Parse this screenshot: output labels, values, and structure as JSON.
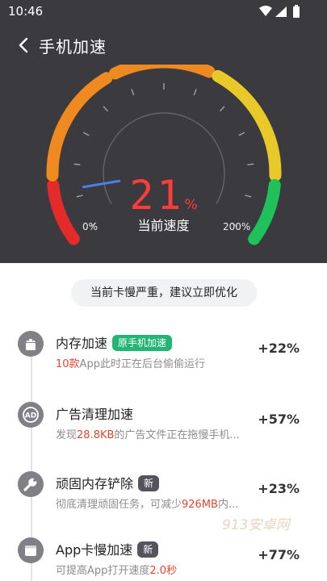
{
  "status_bar": {
    "time": "10:46"
  },
  "header": {
    "title": "手机加速"
  },
  "gauge": {
    "value": "21",
    "unit": "%",
    "value_fraction": 0.105,
    "label": "当前速度",
    "min_label": "0%",
    "max_label": "200%",
    "colors": {
      "red": "#e52a2a",
      "orange": "#ef8a20",
      "yellow": "#e9c82a",
      "green": "#1fc25a",
      "needle": "#4b7cf0"
    }
  },
  "warning": {
    "text": "当前卡慢严重，建议立即优化"
  },
  "items": [
    {
      "icon": "android-icon",
      "title": "内存加速",
      "badge": "原手机加速",
      "sub_highlight": "10款",
      "sub_text": "App此时正在后台偷偷运行",
      "gain": "+22%"
    },
    {
      "icon": "ad-icon",
      "title": "广告清理加速",
      "badge": "",
      "sub_prefix": "发现",
      "sub_highlight": "28.8KB",
      "sub_text": "的广告文件正在拖慢手机...",
      "gain": "+57%"
    },
    {
      "icon": "wrench-icon",
      "title": "顽固内存铲除",
      "badge": "新",
      "sub_prefix": "彻底清理顽固任务，可减少",
      "sub_highlight": "926MB",
      "sub_text": "内...",
      "gain": "+23%"
    },
    {
      "icon": "window-icon",
      "title": "App卡慢加速",
      "badge": "新",
      "sub_prefix": "可提高App打开速度",
      "sub_highlight": "2.0秒",
      "sub_text": "",
      "gain": "+77%"
    }
  ],
  "watermark": "913安卓网"
}
